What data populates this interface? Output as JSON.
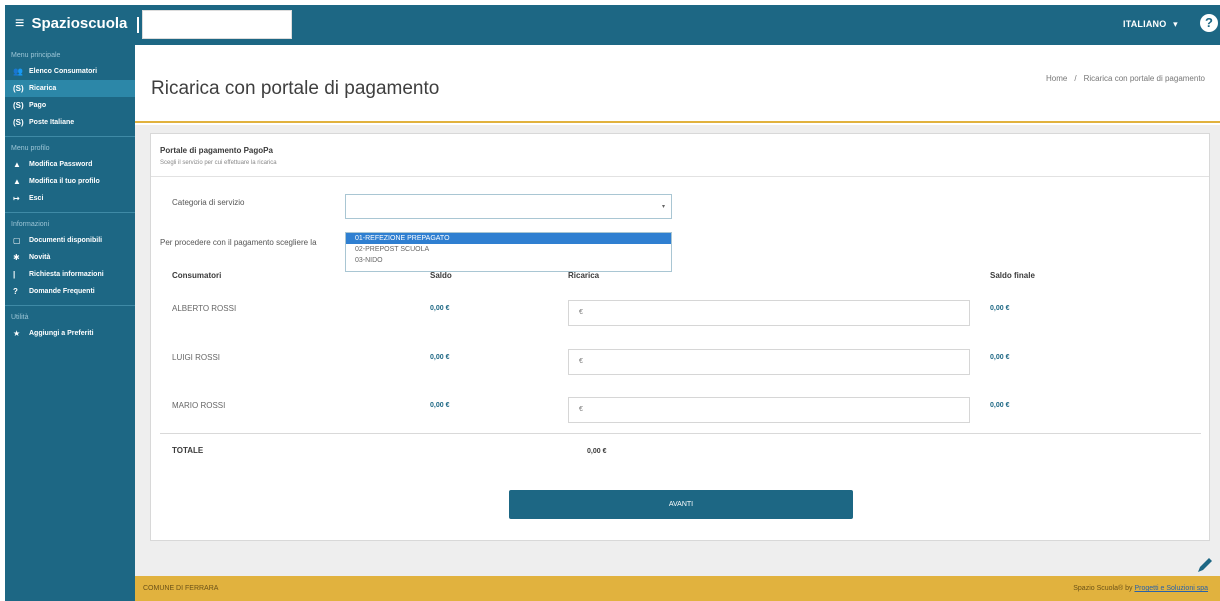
{
  "topbar": {
    "brand": "Spazioscuola",
    "language": "ITALIANO",
    "language_caret": "▾",
    "help_glyph": "?"
  },
  "sidebar": {
    "sections": [
      {
        "title": "Menu principale",
        "items": [
          {
            "label": "Elenco Consumatori",
            "icon": "users-icon",
            "glyph": "👥"
          },
          {
            "label": "Ricarica",
            "icon": "money-icon",
            "glyph": "(S)",
            "active": true
          },
          {
            "label": "Pago",
            "icon": "money-icon",
            "glyph": "(S)"
          },
          {
            "label": "Poste Italiane",
            "icon": "money-icon",
            "glyph": "(S)"
          }
        ]
      },
      {
        "title": "Menu profilo",
        "items": [
          {
            "label": "Modifica Password",
            "icon": "user-icon",
            "glyph": "▲"
          },
          {
            "label": "Modifica il tuo profilo",
            "icon": "user-icon",
            "glyph": "▲"
          },
          {
            "label": "Esci",
            "icon": "logout-icon",
            "glyph": "↦"
          }
        ]
      },
      {
        "title": "Informazioni",
        "items": [
          {
            "label": "Documenti disponibili",
            "icon": "document-icon",
            "glyph": "▢"
          },
          {
            "label": "Novità",
            "icon": "gear-icon",
            "glyph": "✱"
          },
          {
            "label": "Richiesta informazioni",
            "icon": "info-icon",
            "glyph": "|"
          },
          {
            "label": "Domande Frequenti",
            "icon": "question-icon",
            "glyph": "?"
          }
        ]
      },
      {
        "title": "Utilità",
        "items": [
          {
            "label": "Aggiungi a Preferiti",
            "icon": "star-icon",
            "glyph": "★"
          }
        ]
      }
    ]
  },
  "header": {
    "title": "Ricarica con portale di pagamento",
    "breadcrumb": [
      "Home",
      "Ricarica con portale di pagamento"
    ],
    "breadcrumb_sep": "/"
  },
  "panel": {
    "title": "Portale di pagamento PagoPa",
    "subtitle": "Scegli il servizio per cui effettuare la ricarica",
    "category_label": "Categoria di servizio",
    "category_value": "",
    "select_arrow": "▾",
    "hint": "Per procedere con il pagamento scegliere la",
    "dropdown_options": [
      "01-REFEZIONE PREPAGATO",
      "02-PREPOST SCUOLA",
      "03-NIDO"
    ],
    "dropdown_selected": 0,
    "columns": {
      "consumatori": "Consumatori",
      "saldo": "Saldo",
      "ricarica": "Ricarica",
      "saldo_finale": "Saldo finale"
    },
    "rows": [
      {
        "name": "ALBERTO ROSSI",
        "saldo": "0,00 €",
        "ricarica_prefix": "€",
        "saldo_finale": "0,00 €"
      },
      {
        "name": "LUIGI ROSSI",
        "saldo": "0,00 €",
        "ricarica_prefix": "€",
        "saldo_finale": "0,00 €"
      },
      {
        "name": "MARIO ROSSI",
        "saldo": "0,00 €",
        "ricarica_prefix": "€",
        "saldo_finale": "0,00 €"
      }
    ],
    "totale_label": "TOTALE",
    "totale_value": "0,00 €",
    "button_label": "AVANTI"
  },
  "footer": {
    "left": "COMUNE DI FERRARA",
    "right_prefix": "Spazio Scuola® by",
    "right_link": "Progetti e Soluzioni spa"
  },
  "colors": {
    "primary": "#1d6784",
    "accent": "#e1b23e",
    "selected_option": "#2f7fd1"
  }
}
